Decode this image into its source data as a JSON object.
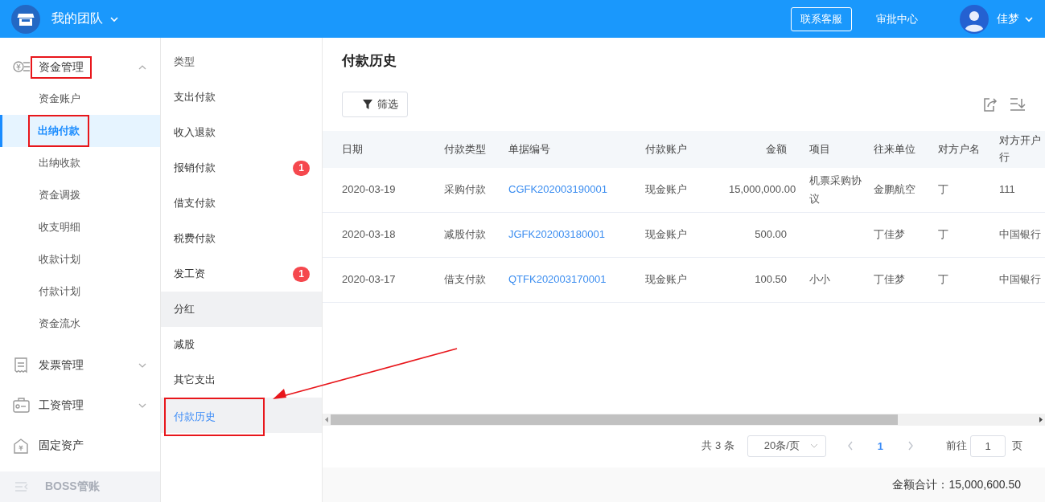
{
  "header": {
    "team": "我的团队",
    "support_button": "联系客服",
    "approval_link": "审批中心",
    "user": "佳梦"
  },
  "sidebar": {
    "groups": [
      {
        "label": "资金管理",
        "expanded": true,
        "annotated": true,
        "children": [
          {
            "label": "资金账户",
            "selected": false,
            "annotated": false
          },
          {
            "label": "出纳付款",
            "selected": true,
            "annotated": true
          },
          {
            "label": "出纳收款",
            "selected": false,
            "annotated": false
          },
          {
            "label": "资金调拨",
            "selected": false,
            "annotated": false
          },
          {
            "label": "收支明细",
            "selected": false,
            "annotated": false
          },
          {
            "label": "收款计划",
            "selected": false,
            "annotated": false
          },
          {
            "label": "付款计划",
            "selected": false,
            "annotated": false
          },
          {
            "label": "资金流水",
            "selected": false,
            "annotated": false
          }
        ]
      },
      {
        "label": "发票管理",
        "expanded": false,
        "annotated": false
      },
      {
        "label": "工资管理",
        "expanded": false,
        "annotated": false
      },
      {
        "label": "固定资产",
        "annotated": false
      }
    ],
    "footer": "BOSS管账"
  },
  "types": {
    "heading": "类型",
    "items": [
      {
        "label": "支出付款",
        "selected": false,
        "hover": false,
        "annotated": false
      },
      {
        "label": "收入退款",
        "selected": false,
        "hover": false,
        "annotated": false
      },
      {
        "label": "报销付款",
        "badge": "1",
        "selected": false,
        "hover": false,
        "annotated": false
      },
      {
        "label": "借支付款",
        "selected": false,
        "hover": false,
        "annotated": false
      },
      {
        "label": "税费付款",
        "selected": false,
        "hover": false,
        "annotated": false
      },
      {
        "label": "发工资",
        "badge": "1",
        "selected": false,
        "hover": false,
        "annotated": false
      },
      {
        "label": "分红",
        "selected": false,
        "hover": true,
        "annotated": false
      },
      {
        "label": "减股",
        "selected": false,
        "hover": false,
        "annotated": false
      },
      {
        "label": "其它支出",
        "selected": false,
        "hover": false,
        "annotated": false
      },
      {
        "label": "付款历史",
        "selected": true,
        "hover": false,
        "annotated": true
      }
    ]
  },
  "callout_arrow": true,
  "main": {
    "title": "付款历史",
    "filter_button": "筛选",
    "table": {
      "columns": [
        {
          "label": "日期",
          "kind": "text"
        },
        {
          "label": "付款类型",
          "kind": "text"
        },
        {
          "label": "单据编号",
          "kind": "link"
        },
        {
          "label": "付款账户",
          "kind": "text"
        },
        {
          "label": "金额",
          "kind": "amount"
        },
        {
          "label": "项目",
          "kind": "text"
        },
        {
          "label": "往来单位",
          "kind": "text"
        },
        {
          "label": "对方户名",
          "kind": "text"
        },
        {
          "label": "对方开户行",
          "kind": "text"
        }
      ],
      "rows": [
        [
          "2020-03-19",
          "采购付款",
          "CGFK202003190001",
          "现金账户",
          "15,000,000.00",
          "机票采购协议",
          "金鹏航空",
          "丁",
          "111"
        ],
        [
          "2020-03-18",
          "减股付款",
          "JGFK202003180001",
          "现金账户",
          "500.00",
          "",
          "丁佳梦",
          "丁",
          "中国银行"
        ],
        [
          "2020-03-17",
          "借支付款",
          "QTFK202003170001",
          "现金账户",
          "100.50",
          "小小",
          "丁佳梦",
          "丁",
          "中国银行"
        ]
      ]
    },
    "pagination": {
      "total": "共 3 条",
      "page_size": "20条/页",
      "current_page": "1",
      "goto_label": "前往",
      "goto_value": "1",
      "page_suffix": "页"
    },
    "total": "金额合计：15,000,600.50"
  }
}
